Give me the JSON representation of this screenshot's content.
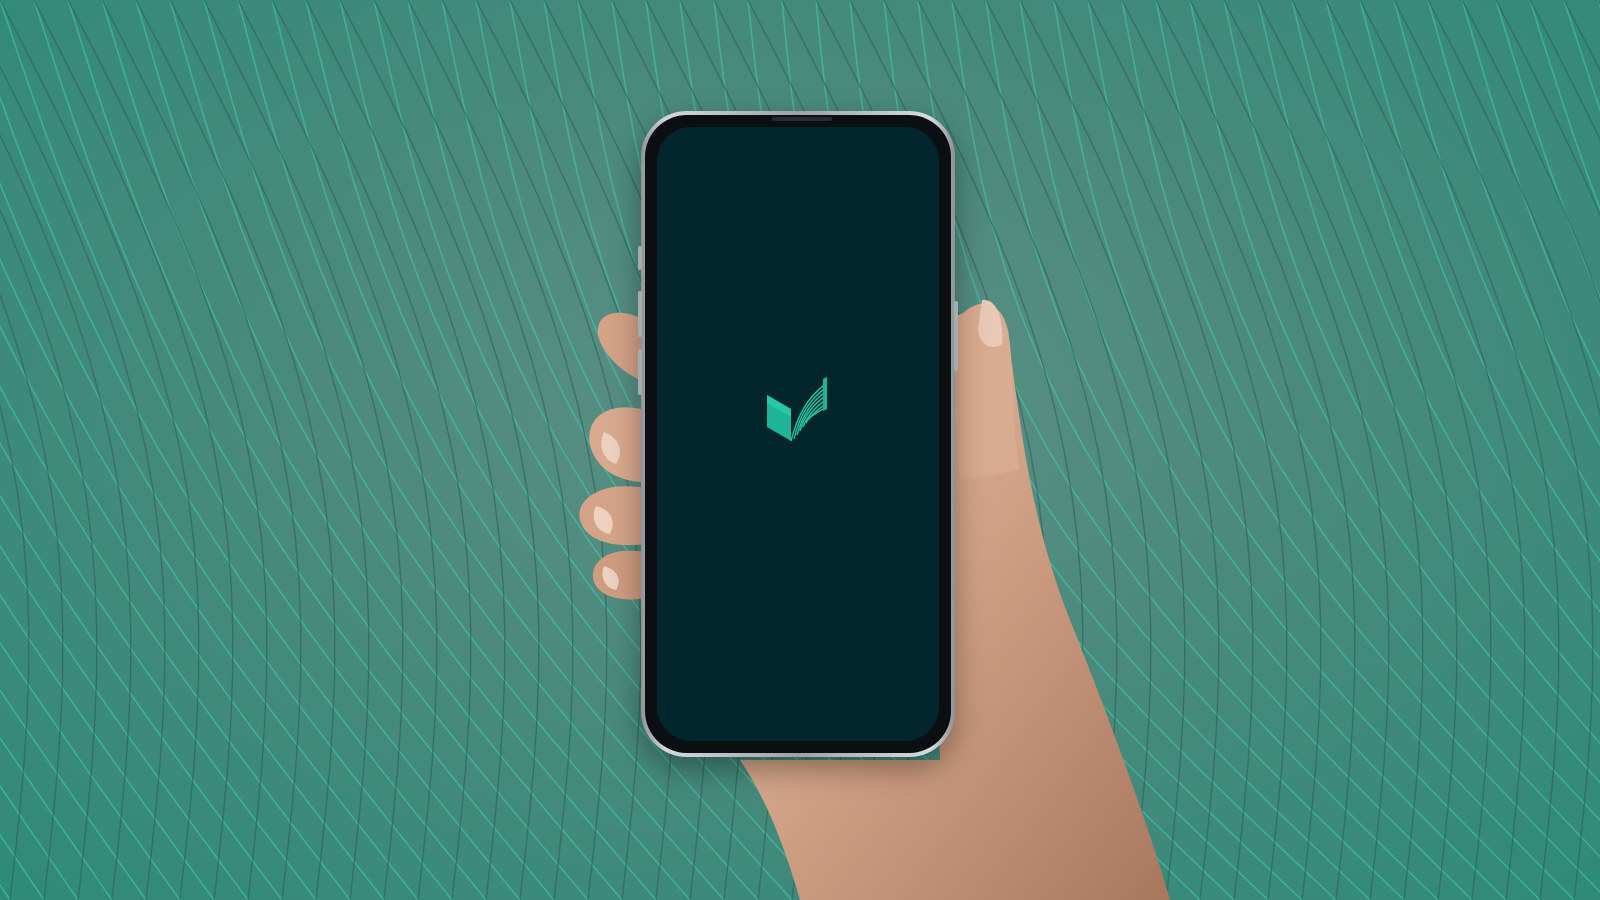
{
  "scene": {
    "description_icon": "app-logo-icon",
    "colors": {
      "background_dark": "#2f8a78",
      "background_mid": "#5d8f85",
      "pattern_line": "#3fd0b0",
      "pattern_shadow": "#2e5e56",
      "screen": "#03262e",
      "logo": "#1fb497",
      "skin": "#d6a88c"
    }
  }
}
